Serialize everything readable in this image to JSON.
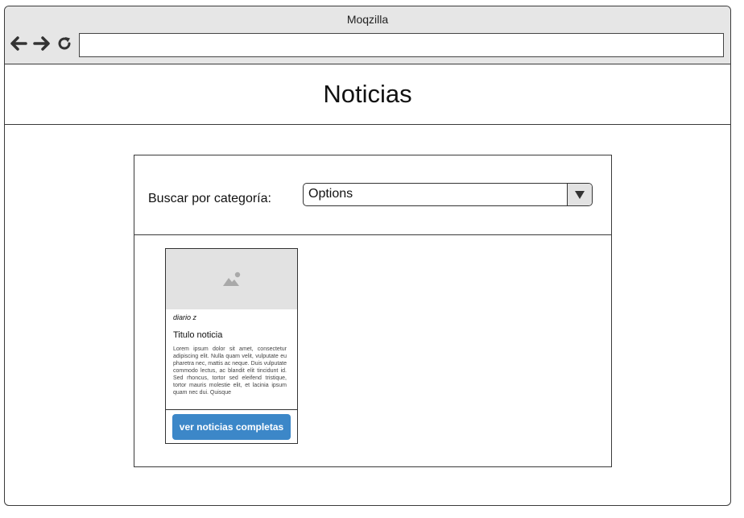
{
  "window": {
    "title": "Moqzilla"
  },
  "browser": {
    "url": ""
  },
  "page": {
    "title": "Noticias"
  },
  "filter": {
    "label": "Buscar por categoría:",
    "select_value": "Options"
  },
  "news_card": {
    "source": "diario z",
    "title": "Titulo noticia",
    "body": "Lorem ipsum dolor sit amet, consectetur adipiscing elit. Nulla quam velit, vulputate eu pharetra nec, mattis ac neque. Duis vulputate commodo lectus, ac blandit elit tincidunt id. Sed rhoncus, tortor sed eleifend tristique, tortor mauris molestie elit, et lacinia ipsum quam nec dui. Quisque",
    "button_label": "ver noticias completas"
  },
  "icons": {
    "back": "arrow-left-icon",
    "forward": "arrow-right-icon",
    "reload": "reload-icon",
    "dropdown": "triangle-down-icon",
    "image": "image-placeholder-icon"
  },
  "colors": {
    "button": "#3c87c8",
    "chrome": "#e6e6e6",
    "placeholder": "#e2e2e2"
  }
}
